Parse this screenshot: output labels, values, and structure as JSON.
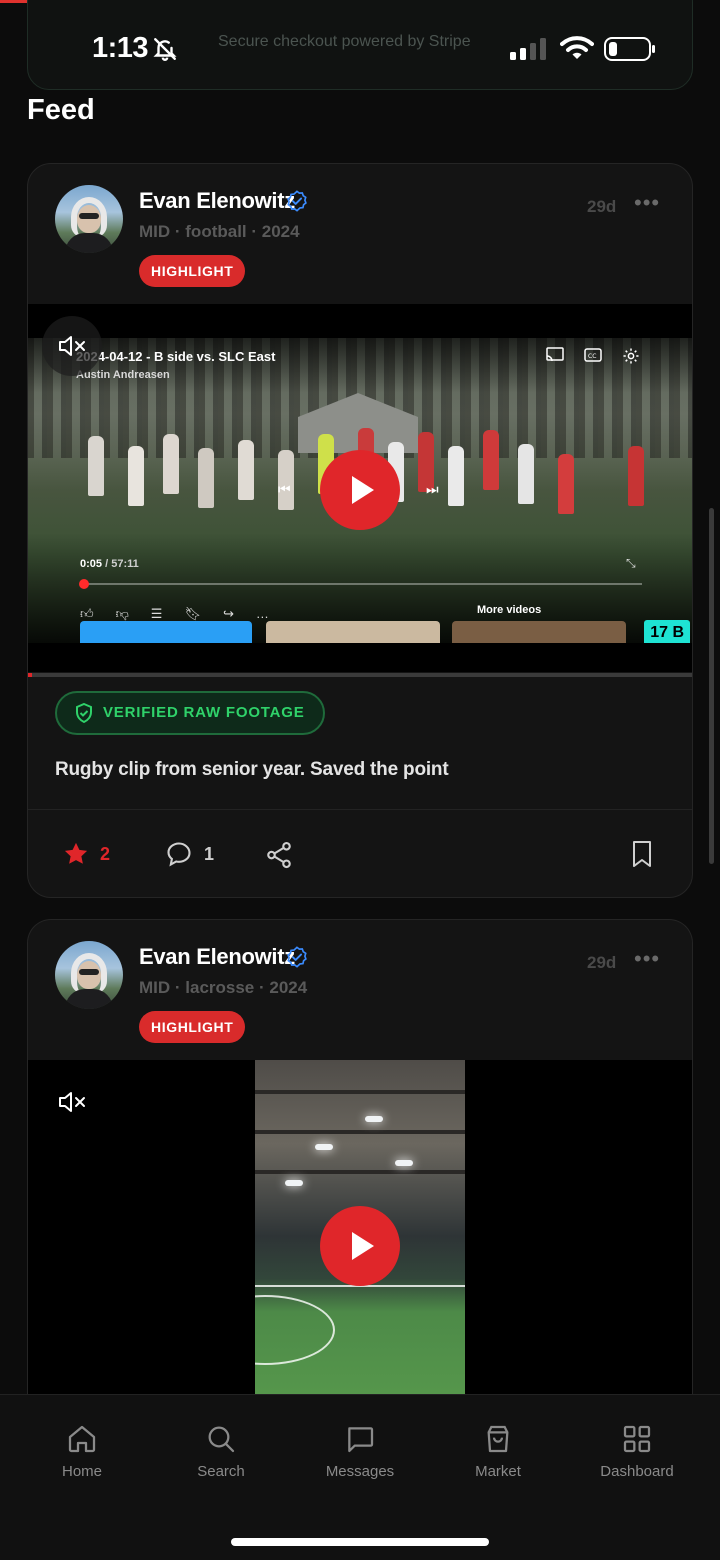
{
  "status_bar": {
    "time": "1:13",
    "note": "Secure checkout powered by Stripe",
    "icons": [
      "bell-slash-icon",
      "signal-icon",
      "wifi-icon",
      "battery-icon"
    ]
  },
  "feed": {
    "title": "Feed",
    "posts": [
      {
        "author": "Evan Elenowitz",
        "meta": "MID · football · 2024",
        "badge": "HIGHLIGHT",
        "time_ago": "29d",
        "video": {
          "title": "2024-04-12 - B side vs. SLC East",
          "channel": "Austin Andreasen",
          "current_time": "0:05",
          "duration": "/ 57:11",
          "more_videos": "More videos",
          "end_label": "17 B",
          "playback_progress": 0.006
        },
        "verified_label": "VERIFIED RAW FOOTAGE",
        "caption": "Rugby clip from senior year. Saved the point",
        "stars": "2",
        "comments": "1"
      },
      {
        "author": "Evan Elenowitz",
        "meta": "MID · lacrosse · 2024",
        "badge": "HIGHLIGHT",
        "time_ago": "29d"
      }
    ]
  },
  "bottom_nav": {
    "items": [
      {
        "label": "Home",
        "icon": "home-icon"
      },
      {
        "label": "Search",
        "icon": "search-icon"
      },
      {
        "label": "Messages",
        "icon": "messages-icon"
      },
      {
        "label": "Market",
        "icon": "market-bag-icon"
      },
      {
        "label": "Dashboard",
        "icon": "dashboard-grid-icon"
      }
    ]
  },
  "colors": {
    "accent_red": "#e0262a",
    "verified_green": "#2fd26a",
    "background": "#0c0c0c",
    "card": "#141414"
  }
}
